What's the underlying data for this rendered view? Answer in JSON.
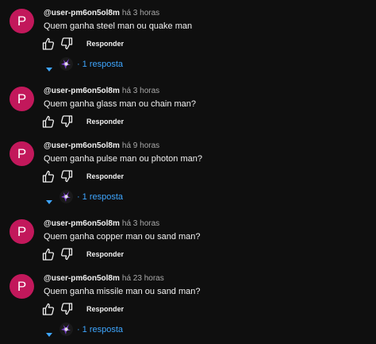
{
  "comments": [
    {
      "avatar_letter": "P",
      "author": "@user-pm6on5ol8m",
      "time": "há 3 horas",
      "text": "Quem ganha steel man ou quake man",
      "reply_label": "Responder",
      "replies_label": "1 resposta"
    },
    {
      "avatar_letter": "P",
      "author": "@user-pm6on5ol8m",
      "time": "há 3 horas",
      "text": "Quem ganha glass man ou chain man?",
      "reply_label": "Responder"
    },
    {
      "avatar_letter": "P",
      "author": "@user-pm6on5ol8m",
      "time": "há 9 horas",
      "text": "Quem ganha pulse man ou photon man?",
      "reply_label": "Responder",
      "replies_label": "1 resposta"
    },
    {
      "avatar_letter": "P",
      "author": "@user-pm6on5ol8m",
      "time": "há 3 horas",
      "text": "Quem ganha copper man ou sand man?",
      "reply_label": "Responder"
    },
    {
      "avatar_letter": "P",
      "author": "@user-pm6on5ol8m",
      "time": "há 23 horas",
      "text": "Quem ganha missile man ou sand man?",
      "reply_label": "Responder",
      "replies_label": "1 resposta"
    }
  ],
  "icons": {
    "like": "thumbs-up-icon",
    "dislike": "thumbs-down-icon",
    "expand": "chevron-down-icon",
    "reply_avatar": "creator-avatar-icon"
  },
  "colors": {
    "background": "#0f0f0f",
    "avatar": "#c2185b",
    "link": "#3ea6ff",
    "text": "#f1f1f1",
    "muted": "#aaaaaa"
  }
}
